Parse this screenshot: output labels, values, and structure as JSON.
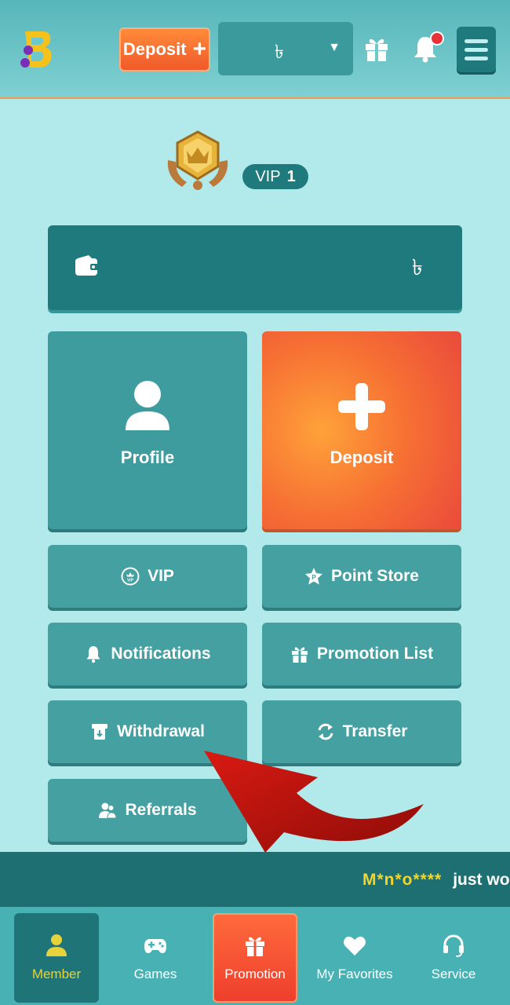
{
  "header": {
    "deposit_label": "Deposit",
    "currency_symbol": "৳",
    "caret": "▼"
  },
  "vip": {
    "label": "VIP",
    "level": "1"
  },
  "wallet": {
    "currency_symbol": "৳"
  },
  "tiles": {
    "profile": "Profile",
    "deposit": "Deposit",
    "vip": "VIP",
    "point_store": "Point Store",
    "notifications": "Notifications",
    "promotion_list": "Promotion List",
    "withdrawal": "Withdrawal",
    "transfer": "Transfer",
    "referrals": "Referrals"
  },
  "ticker": {
    "user": "M*n*o****",
    "message": "just wo"
  },
  "bottom_nav": {
    "member": "Member",
    "games": "Games",
    "promotion": "Promotion",
    "my_favorites": "My Favorites",
    "service": "Service"
  },
  "colors": {
    "page_bg": "#b2e9ea",
    "teal_dark": "#1e7a7c",
    "tile_teal": "#45a0a2",
    "orange_accent": "#f67033",
    "ticker_name": "#f3d629",
    "notification_dot": "#e8323a"
  },
  "icons": {
    "logo": "brand-logo",
    "gift": "gift-icon",
    "bell": "bell-icon",
    "menu": "hamburger-menu-icon",
    "wallet": "wallet-icon",
    "profile": "user-icon",
    "deposit": "plus-icon",
    "vip": "vip-crown-icon",
    "point_store": "star-badge-icon",
    "notifications": "bell-icon",
    "promotion_list": "gift-icon",
    "withdrawal": "atm-icon",
    "transfer": "swap-arrows-icon",
    "referrals": "people-icon",
    "games": "gamepad-icon",
    "favorites": "heart-icon",
    "service": "headset-icon"
  }
}
